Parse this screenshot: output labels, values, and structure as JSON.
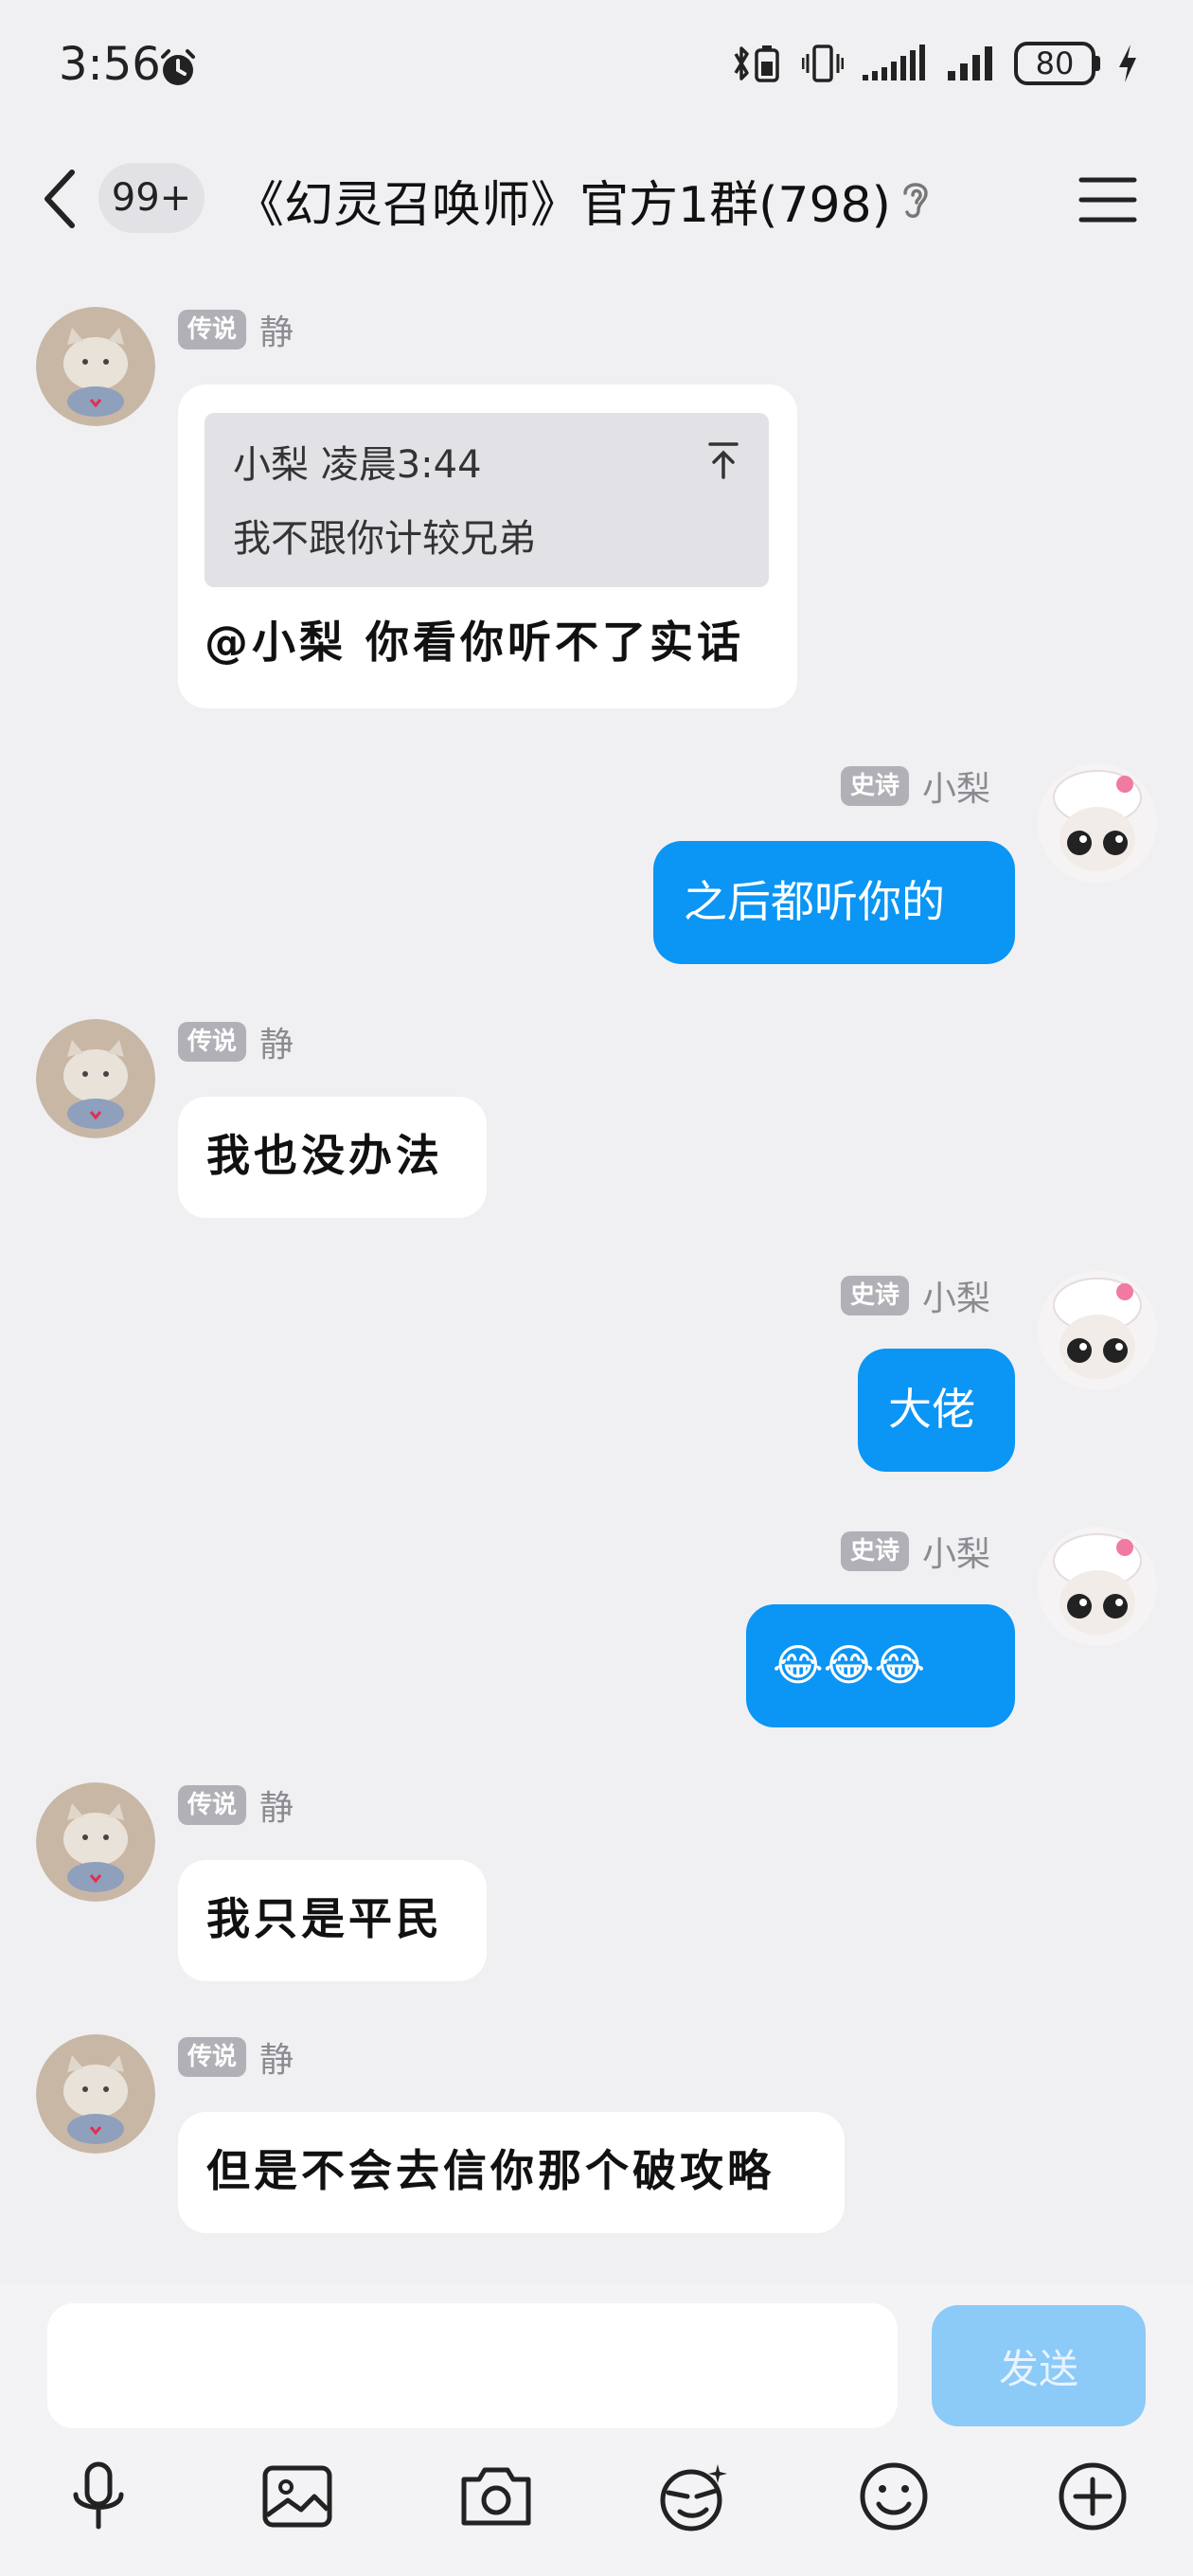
{
  "status_bar": {
    "time": "3:56",
    "battery": "80"
  },
  "header": {
    "unread_count": "99+",
    "title": "《幻灵召唤师》官方1群(798)"
  },
  "messages": [
    {
      "sender": "静",
      "rank": "传说",
      "direction": "in",
      "quote": {
        "author_time": "小梨 凌晨3:44",
        "text": "我不跟你计较兄弟"
      },
      "text": "@小梨 你看你听不了实话"
    },
    {
      "sender": "小梨",
      "rank": "史诗",
      "direction": "out",
      "text": "之后都听你的"
    },
    {
      "sender": "静",
      "rank": "传说",
      "direction": "in",
      "text": "我也没办法"
    },
    {
      "sender": "小梨",
      "rank": "史诗",
      "direction": "out",
      "text": "大佬"
    },
    {
      "sender": "小梨",
      "rank": "史诗",
      "direction": "out",
      "text": "😂😂😂"
    },
    {
      "sender": "静",
      "rank": "传说",
      "direction": "in",
      "text": "我只是平民"
    },
    {
      "sender": "静",
      "rank": "传说",
      "direction": "in",
      "text": "但是不会去信你那个破攻略"
    }
  ],
  "input": {
    "placeholder": "",
    "send_label": "发送"
  },
  "toolbar": {
    "icons": [
      "microphone-icon",
      "image-icon",
      "camera-icon",
      "sticker-icon",
      "emoji-icon",
      "plus-icon"
    ]
  },
  "colors": {
    "background": "#f0f0f3",
    "outgoing_bubble": "#0b95f5",
    "send_button": "#8ccaf8"
  }
}
